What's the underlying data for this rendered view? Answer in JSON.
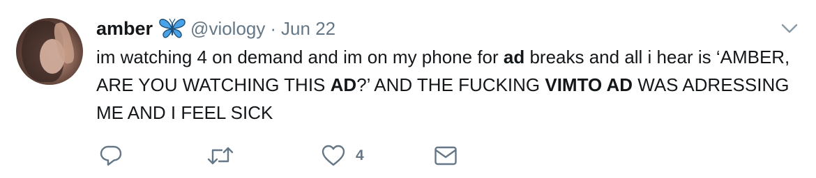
{
  "tweet": {
    "author_name": "amber",
    "author_emoji_icon": "butterfly-icon",
    "handle": "@viology",
    "separator": "·",
    "date": "Jun 22",
    "text_parts": {
      "p1": "im watching 4 on demand and im on my phone for ",
      "b1": "ad",
      "p2": " breaks and all i hear is ‘AMBER, ARE YOU WATCHING THIS ",
      "b2": "AD",
      "p3": "?’ AND THE FUCKING ",
      "b3": "VIMTO AD",
      "p4": " WAS ADRESSING ME AND I FEEL SICK"
    }
  },
  "actions": {
    "reply_icon": "reply-icon",
    "retweet_icon": "retweet-icon",
    "like_icon": "heart-icon",
    "like_count": "4",
    "dm_icon": "envelope-icon"
  },
  "colors": {
    "text": "#14171a",
    "secondary": "#657786",
    "butterfly": "#1da1f2"
  }
}
